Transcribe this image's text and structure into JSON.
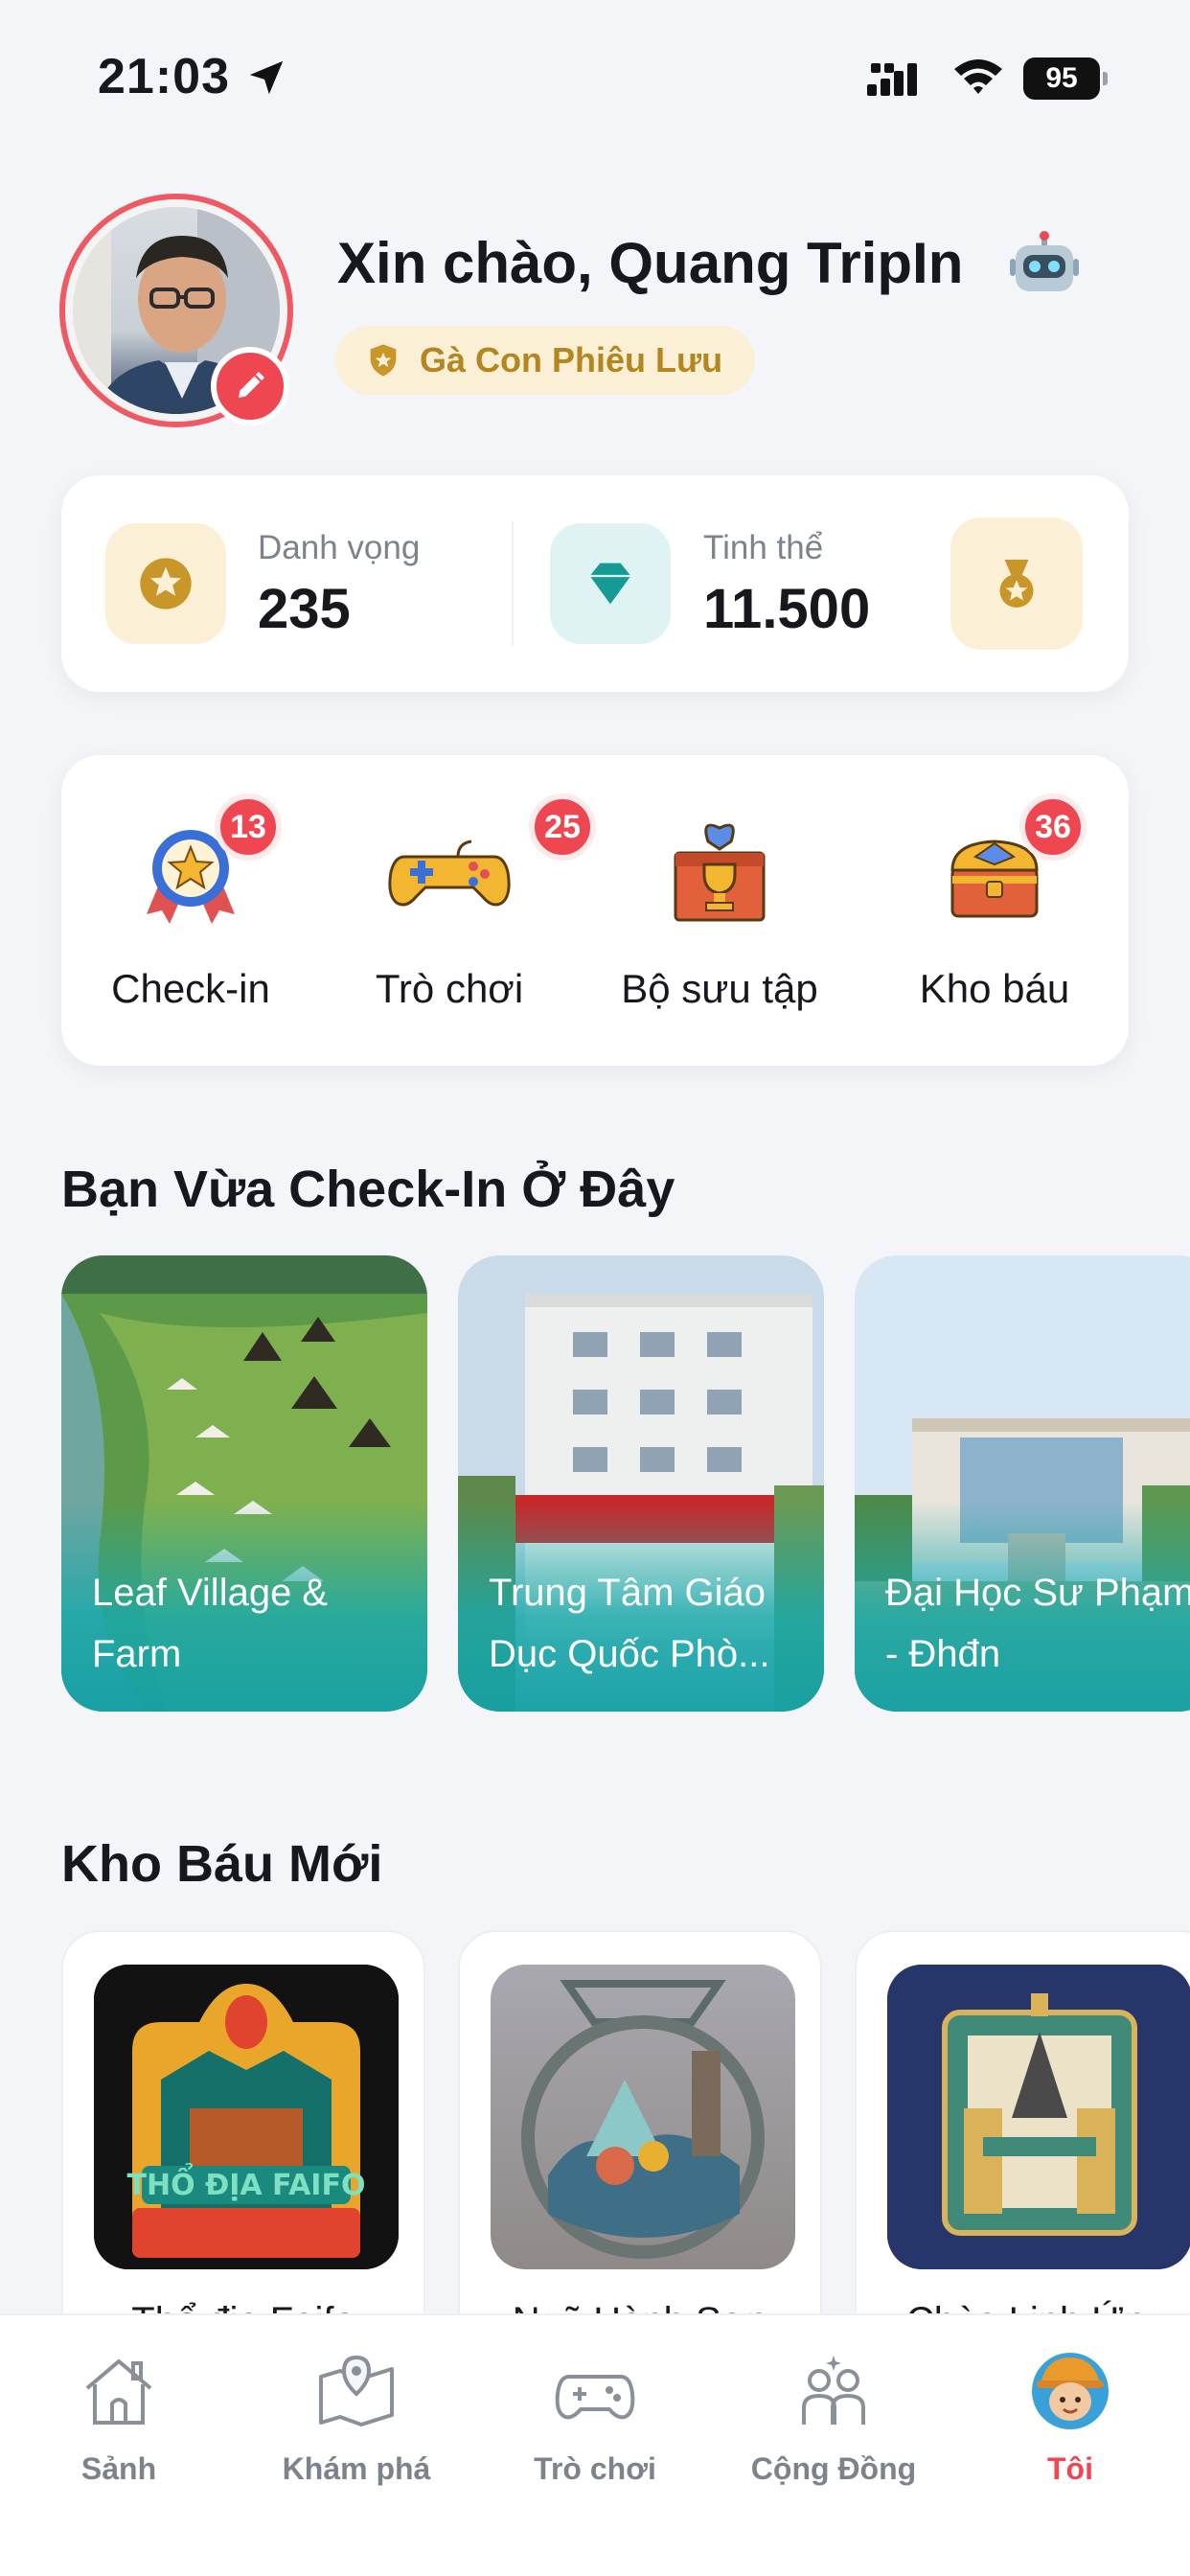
{
  "status_bar": {
    "time": "21:03",
    "battery": "95"
  },
  "profile": {
    "greeting": "Xin chào, Quang TripIn",
    "greeting_icon": "robot-emoji-icon",
    "rank": "Gà Con Phiêu Lưu"
  },
  "stats": [
    {
      "label": "Danh vọng",
      "value": "235",
      "icon": "star-icon"
    },
    {
      "label": "Tinh thể",
      "value": "11.500",
      "icon": "diamond-icon"
    }
  ],
  "actions": [
    {
      "label": "Check-in",
      "count": "13",
      "icon": "medal-badge-icon"
    },
    {
      "label": "Trò chơi",
      "count": "25",
      "icon": "gamepad-icon"
    },
    {
      "label": "Bộ sưu tập",
      "count": "",
      "icon": "trophy-box-icon"
    },
    {
      "label": "Kho báu",
      "count": "36",
      "icon": "treasure-chest-icon"
    }
  ],
  "checkin_section": {
    "title": "Bạn Vừa Check-In Ở Đây",
    "places": [
      {
        "name": "Leaf Village & Farm"
      },
      {
        "name": "Trung Tâm Giáo Dục Quốc Phò..."
      },
      {
        "name": "Đại Học Sư Phạm - Đhđn"
      }
    ]
  },
  "treasure_section": {
    "title": "Kho Báu Mới",
    "items": [
      {
        "name": "Thổ địa Faifo",
        "image_text": "THỔ ĐỊA FAIFO"
      },
      {
        "name": "Ngũ Hành Sơn"
      },
      {
        "name": "Chùa Linh Ứng"
      }
    ]
  },
  "tab_bar": [
    {
      "label": "Sảnh",
      "icon": "home-icon"
    },
    {
      "label": "Khám phá",
      "icon": "map-icon"
    },
    {
      "label": "Trò chơi",
      "icon": "gamepad-icon"
    },
    {
      "label": "Cộng Đồng",
      "icon": "community-icon"
    },
    {
      "label": "Tôi",
      "icon": "avatar-icon",
      "active": true
    }
  ],
  "colors": {
    "accent_red": "#ee4752",
    "gold": "#b3861f",
    "teal": "#1aa8aa",
    "background": "#f3f5f8"
  }
}
